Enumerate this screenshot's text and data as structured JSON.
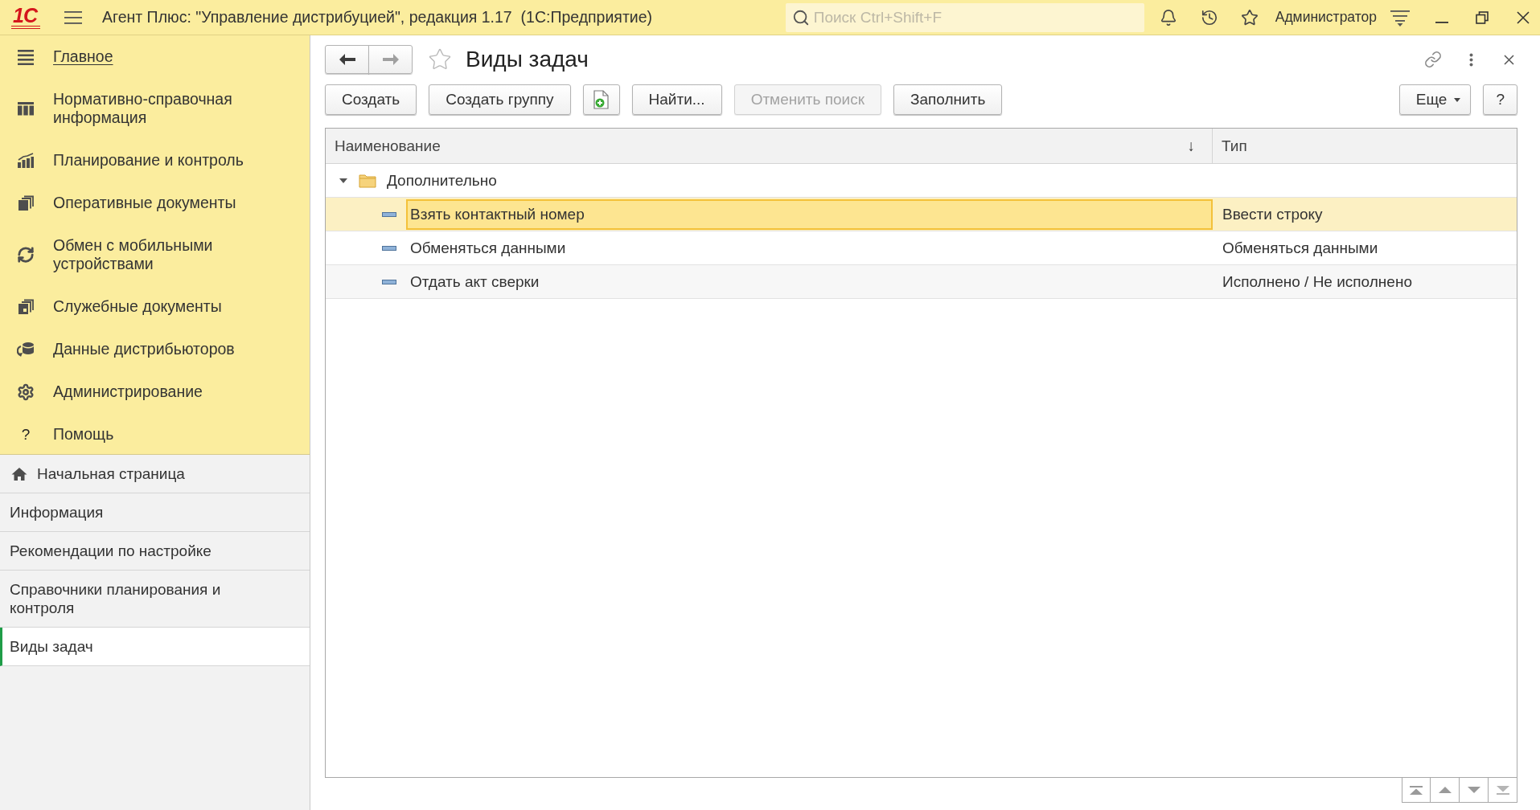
{
  "window": {
    "logo": "1С",
    "title": "Агент Плюс: \"Управление дистрибуцией\", редакция 1.17  (1С:Предприятие)",
    "search": {
      "placeholder": "Поиск Ctrl+Shift+F"
    },
    "user": "Администратор"
  },
  "sections": [
    {
      "label": "Главное",
      "selected": true
    },
    {
      "label": "Нормативно-справочная информация",
      "selected": false
    },
    {
      "label": "Планирование и контроль",
      "selected": false
    },
    {
      "label": "Оперативные документы",
      "selected": false
    },
    {
      "label": "Обмен с мобильными устройствами",
      "selected": false
    },
    {
      "label": "Служебные документы",
      "selected": false
    },
    {
      "label": "Данные дистрибьюторов",
      "selected": false
    },
    {
      "label": "Администрирование",
      "selected": false
    },
    {
      "label": "Помощь",
      "glyph": "?",
      "selected": false
    }
  ],
  "open_pages": [
    {
      "label": "Начальная страница",
      "kind": "home",
      "selected": false
    },
    {
      "label": "Информация",
      "kind": "page",
      "selected": false
    },
    {
      "label": "Рекомендации по настройке",
      "kind": "page",
      "selected": false
    },
    {
      "label": "Справочники планирования и контроля",
      "kind": "page",
      "selected": false
    },
    {
      "label": "Виды задач",
      "kind": "page",
      "selected": true
    }
  ],
  "page": {
    "navigation": [
      {
        "kind": "back",
        "disabled": false
      },
      {
        "kind": "forward",
        "disabled": true
      }
    ],
    "favorite": false,
    "title": "Виды задач"
  },
  "toolbar": {
    "left": [
      {
        "kind": "text",
        "label": "Создать",
        "disabled": false
      },
      {
        "kind": "text",
        "label": "Создать группу",
        "disabled": false
      },
      {
        "kind": "icon",
        "disabled": false
      },
      {
        "kind": "text",
        "label": "Найти...",
        "disabled": false
      },
      {
        "kind": "text",
        "label": "Отменить поиск",
        "disabled": true
      },
      {
        "kind": "text",
        "label": "Заполнить",
        "disabled": false
      }
    ],
    "right": [
      {
        "kind": "menu",
        "label": "Еще",
        "disabled": false
      },
      {
        "kind": "text",
        "label": "?",
        "disabled": false
      }
    ]
  },
  "table": {
    "columns": [
      {
        "label": "Наименование",
        "sort_mark": "↓"
      },
      {
        "label": "Тип"
      }
    ],
    "rows": [
      {
        "kind": "group",
        "name": "Дополнительно",
        "expanded": true,
        "selected": false,
        "children": [
          {
            "kind": "item",
            "name": "Взять контактный номер",
            "type": "Ввести строку",
            "selected": true
          },
          {
            "kind": "item",
            "name": "Обменяться данными",
            "type": "Обменяться данными",
            "selected": false
          },
          {
            "kind": "item",
            "name": "Отдать акт сверки",
            "type": "Исполнено / Не исполнено",
            "selected": false
          }
        ]
      }
    ]
  }
}
